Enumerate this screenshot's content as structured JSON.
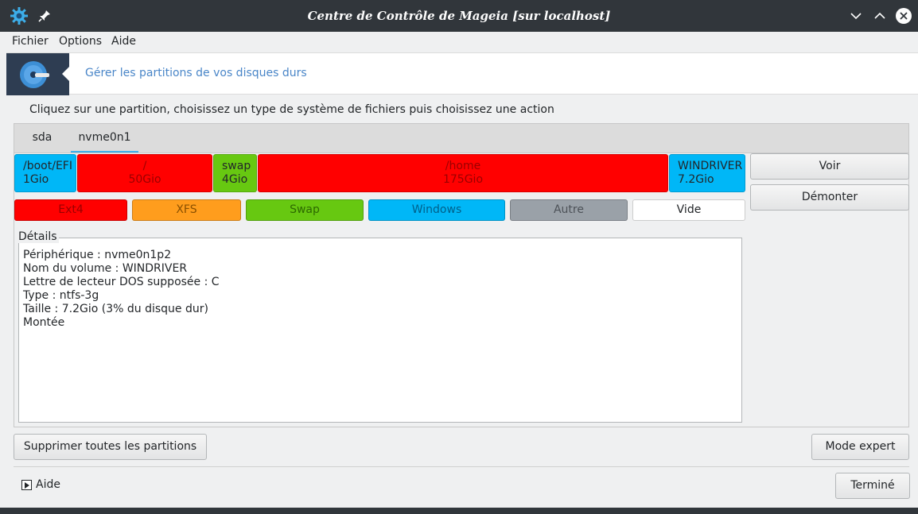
{
  "window": {
    "title": "Centre de Contrôle de Mageia [sur localhost]"
  },
  "menubar": {
    "items": [
      "Fichier",
      "Options",
      "Aide"
    ]
  },
  "banner": {
    "title": "Gérer les partitions de vos disques durs",
    "icon": "harddisk-icon"
  },
  "instruction": "Cliquez sur une partition, choisissez un type de système de fichiers puis choisissez une action",
  "tabs": [
    {
      "label": "sda",
      "active": false
    },
    {
      "label": "nvme0n1",
      "active": true
    }
  ],
  "partitions": [
    {
      "label": "/boot/EFI",
      "size": "1Gio",
      "color": "#00b7f7"
    },
    {
      "label": "/",
      "size": "50Gio",
      "color": "#ff0000"
    },
    {
      "label": "swap",
      "size": "4Gio",
      "color": "#67c811"
    },
    {
      "label": "/home",
      "size": "175Gio",
      "color": "#ff0000"
    },
    {
      "label": "WINDRIVER",
      "size": "7.2Gio",
      "color": "#00b7f7",
      "selected": true
    }
  ],
  "legend": [
    {
      "label": "Ext4",
      "color": "#ff0000"
    },
    {
      "label": "XFS",
      "color": "#ff9d1d"
    },
    {
      "label": "Swap",
      "color": "#67c811"
    },
    {
      "label": "Windows",
      "color": "#00b7f7"
    },
    {
      "label": "Autre",
      "color": "#9aa1a8"
    },
    {
      "label": "Vide",
      "color": "#ffffff"
    }
  ],
  "actions": {
    "voir": "Voir",
    "demonter": "Démonter"
  },
  "details": {
    "label": "Détails",
    "lines": [
      "Périphérique : nvme0n1p2",
      "Nom du volume : WINDRIVER",
      "Lettre de lecteur DOS supposée : C",
      "Type : ntfs-3g",
      "Taille : 7.2Gio (3% du disque dur)",
      "Montée"
    ]
  },
  "buttons": {
    "supprimer": "Supprimer toutes les partitions",
    "expert": "Mode expert",
    "termine": "Terminé"
  },
  "help": {
    "label": "Aide"
  },
  "colors": {
    "titlebar": "#31363b",
    "accent": "#3daee9",
    "banner_text": "#4a86c8"
  }
}
